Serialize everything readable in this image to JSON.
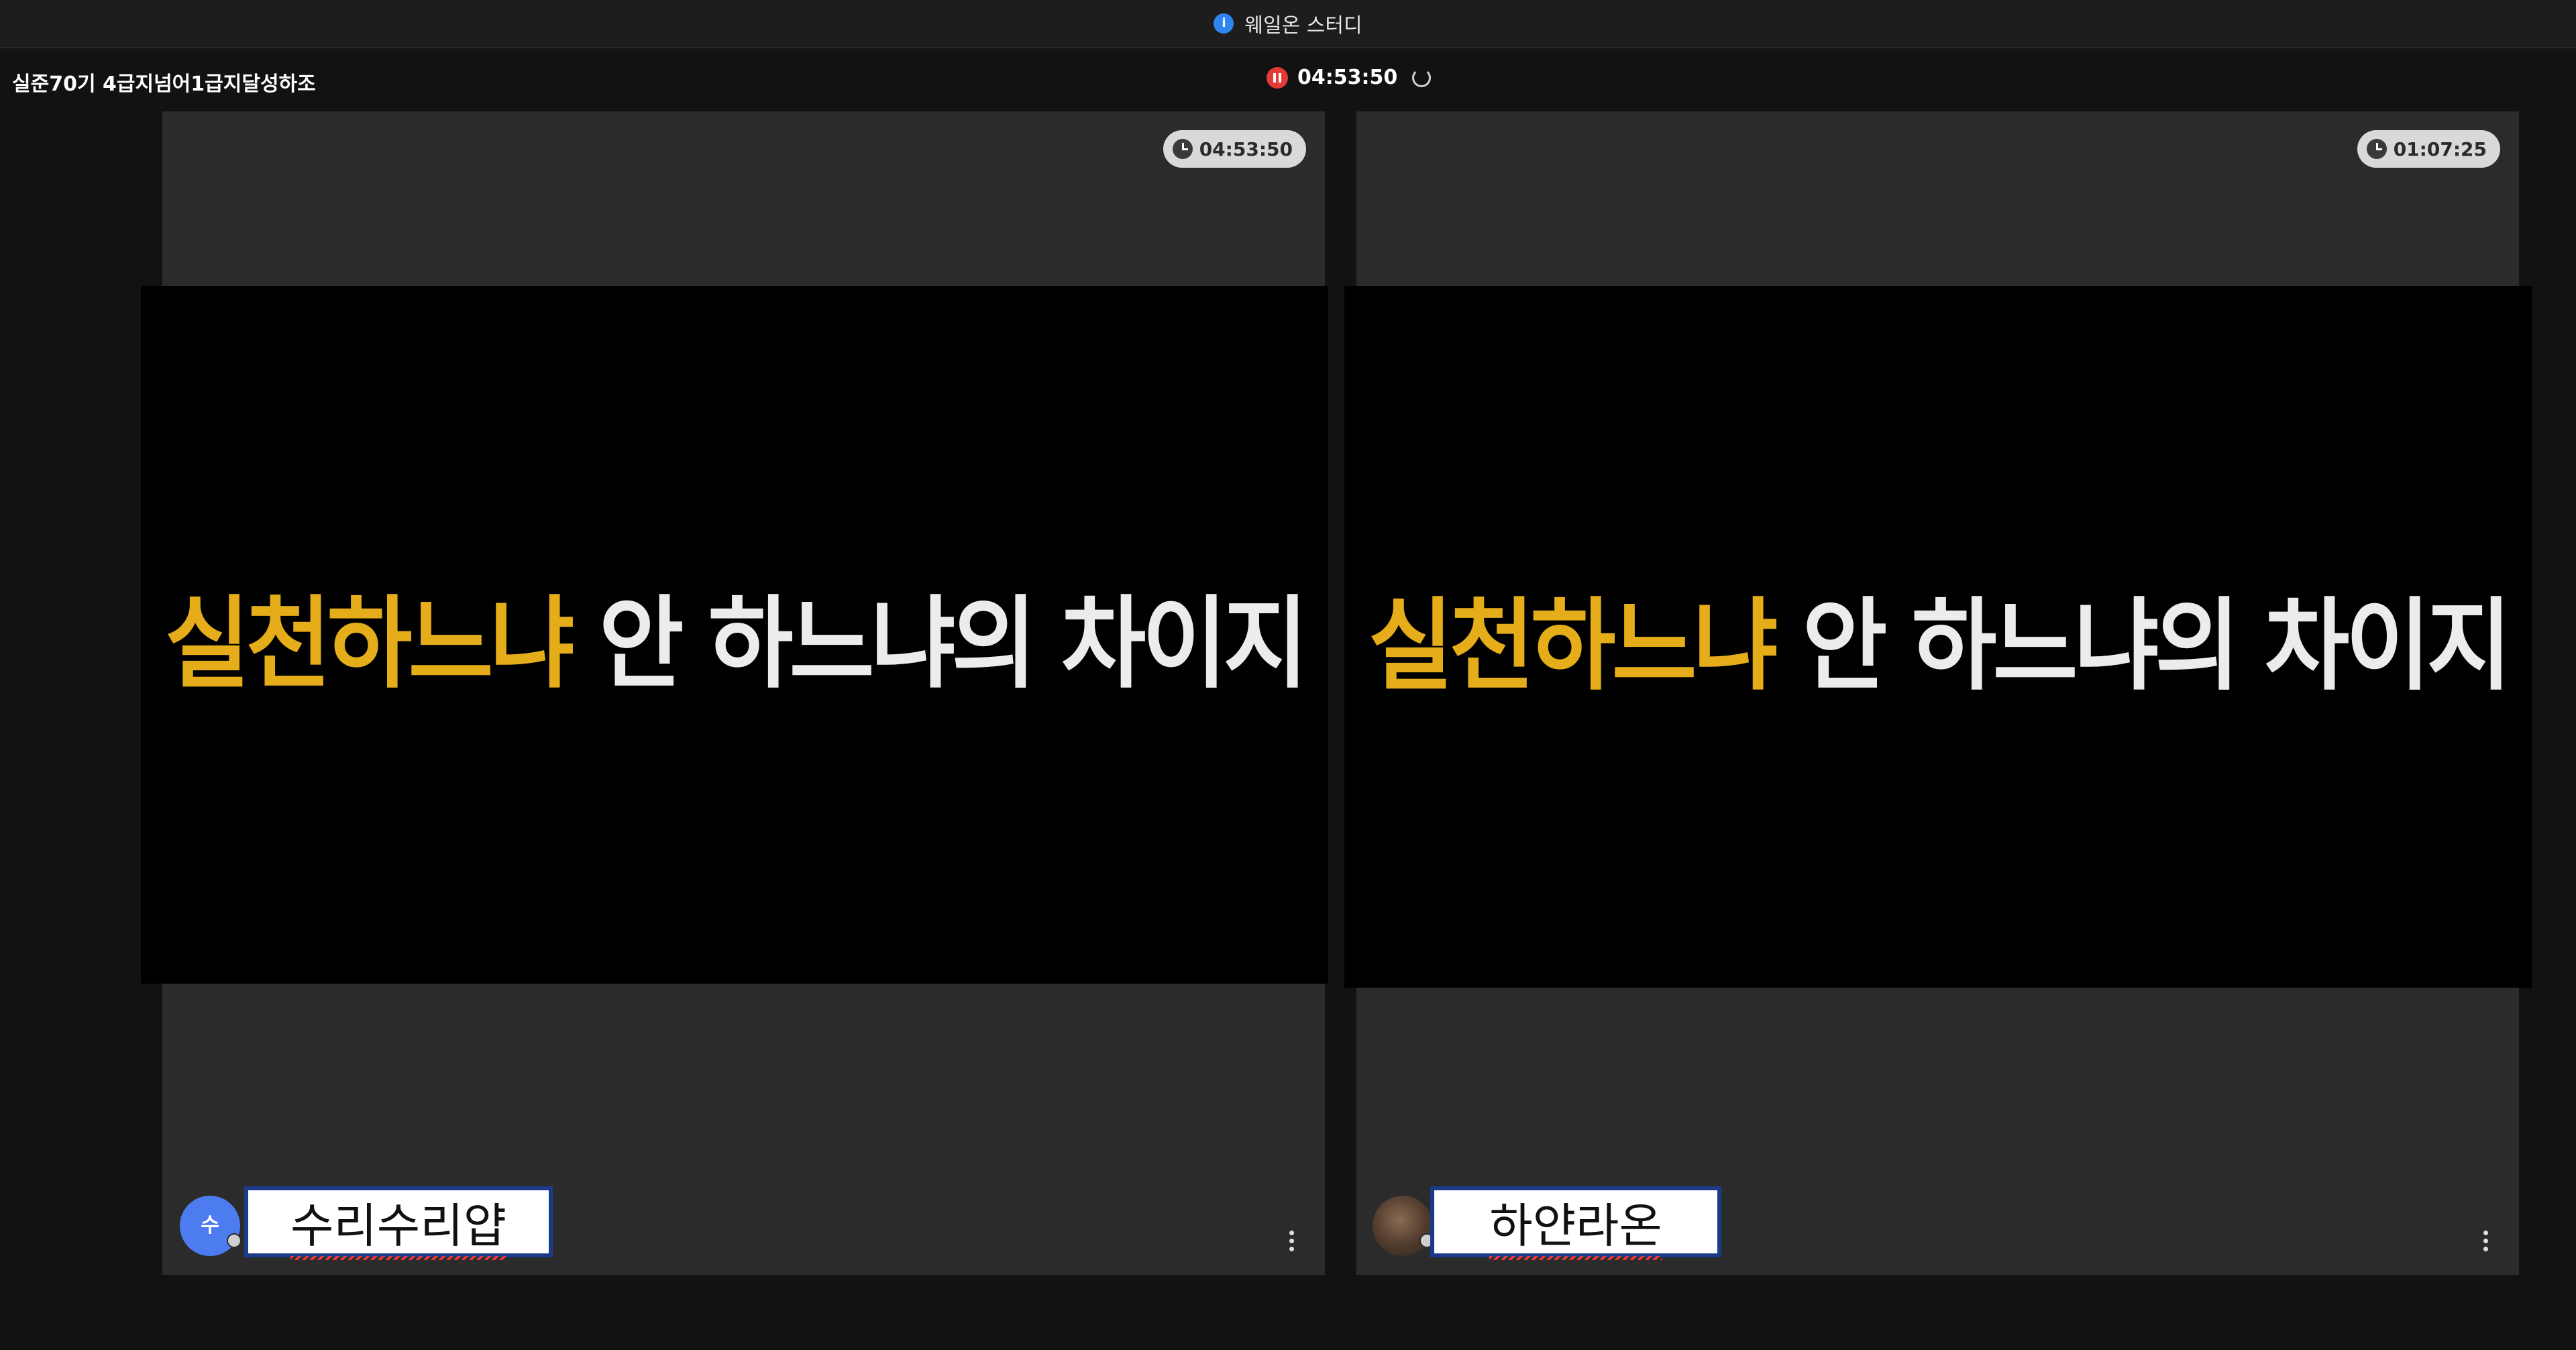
{
  "window": {
    "title": "웨일온 스터디",
    "icon": "whale-on-icon"
  },
  "room": {
    "name": "실준70기 4급지넘어1급지달성하조"
  },
  "session": {
    "elapsed": "04:53:50",
    "record_icon": "pause-record-icon",
    "refresh_icon": "refresh-icon"
  },
  "participants": [
    {
      "name": "수리수리얍",
      "avatar_initial": "수",
      "timer": "04:53:50",
      "caption_yellow": "실천하느냐",
      "caption_white": " 안 하느냐의 차이지"
    },
    {
      "name": "하얀라온",
      "avatar_initial": "",
      "timer": "01:07:25",
      "caption_yellow": "실천하느냐",
      "caption_white": " 안 하느냐의 차이지"
    }
  ],
  "colors": {
    "caption_accent": "#e5ad1a",
    "record": "#e53935",
    "avatar": "#4c7cf0"
  }
}
